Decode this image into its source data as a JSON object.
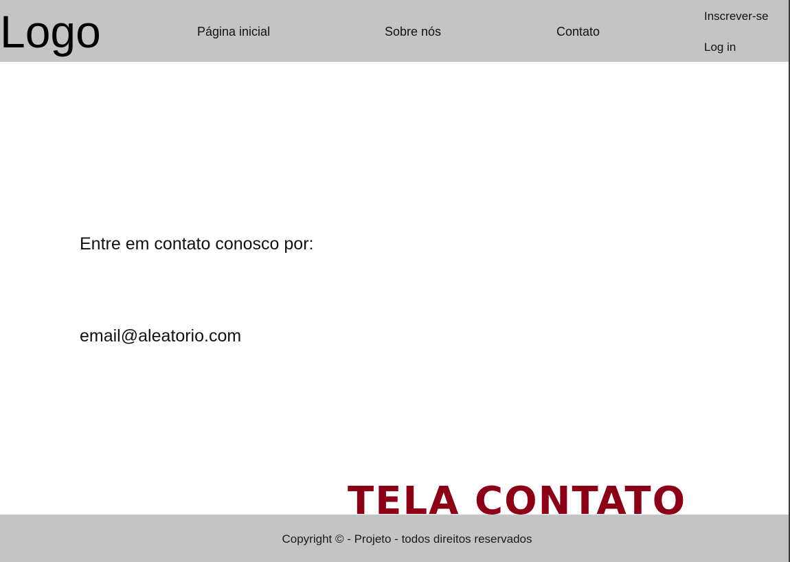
{
  "header": {
    "logo": "Logo",
    "nav": {
      "home": "Página inicial",
      "about": "Sobre nós",
      "contact": "Contato"
    },
    "auth": {
      "signup": "Inscrever-se",
      "login": "Log in"
    }
  },
  "main": {
    "intro": "Entre em contato conosco por:",
    "email": "email@aleatorio.com"
  },
  "footer": {
    "copyright": "Copyright © - Projeto - todos direitos reservados"
  },
  "overlay": {
    "label": "TELA CONTATO",
    "color": "#8b0016"
  },
  "colors": {
    "bar_background": "#c4c4c4",
    "page_background": "#ffffff"
  }
}
